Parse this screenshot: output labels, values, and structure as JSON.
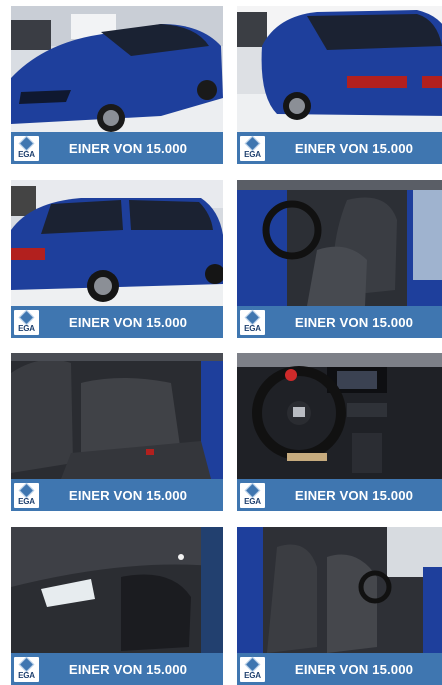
{
  "tiles": [
    {
      "logo": "EGA",
      "caption": "EINER VON 15.000"
    },
    {
      "logo": "EGA",
      "caption": "EINER VON 15.000"
    },
    {
      "logo": "EGA",
      "caption": "EINER VON 15.000"
    },
    {
      "logo": "EGA",
      "caption": "EINER VON 15.000"
    },
    {
      "logo": "EGA",
      "caption": "EINER VON 15.000"
    },
    {
      "logo": "EGA",
      "caption": "EINER VON 15.000"
    },
    {
      "logo": "EGA",
      "caption": "EINER VON 15.000"
    },
    {
      "logo": "EGA",
      "caption": "EINER VON 15.000"
    }
  ],
  "colors": {
    "banner": "#3f76b0",
    "car_blue": "#1e3f9c"
  }
}
